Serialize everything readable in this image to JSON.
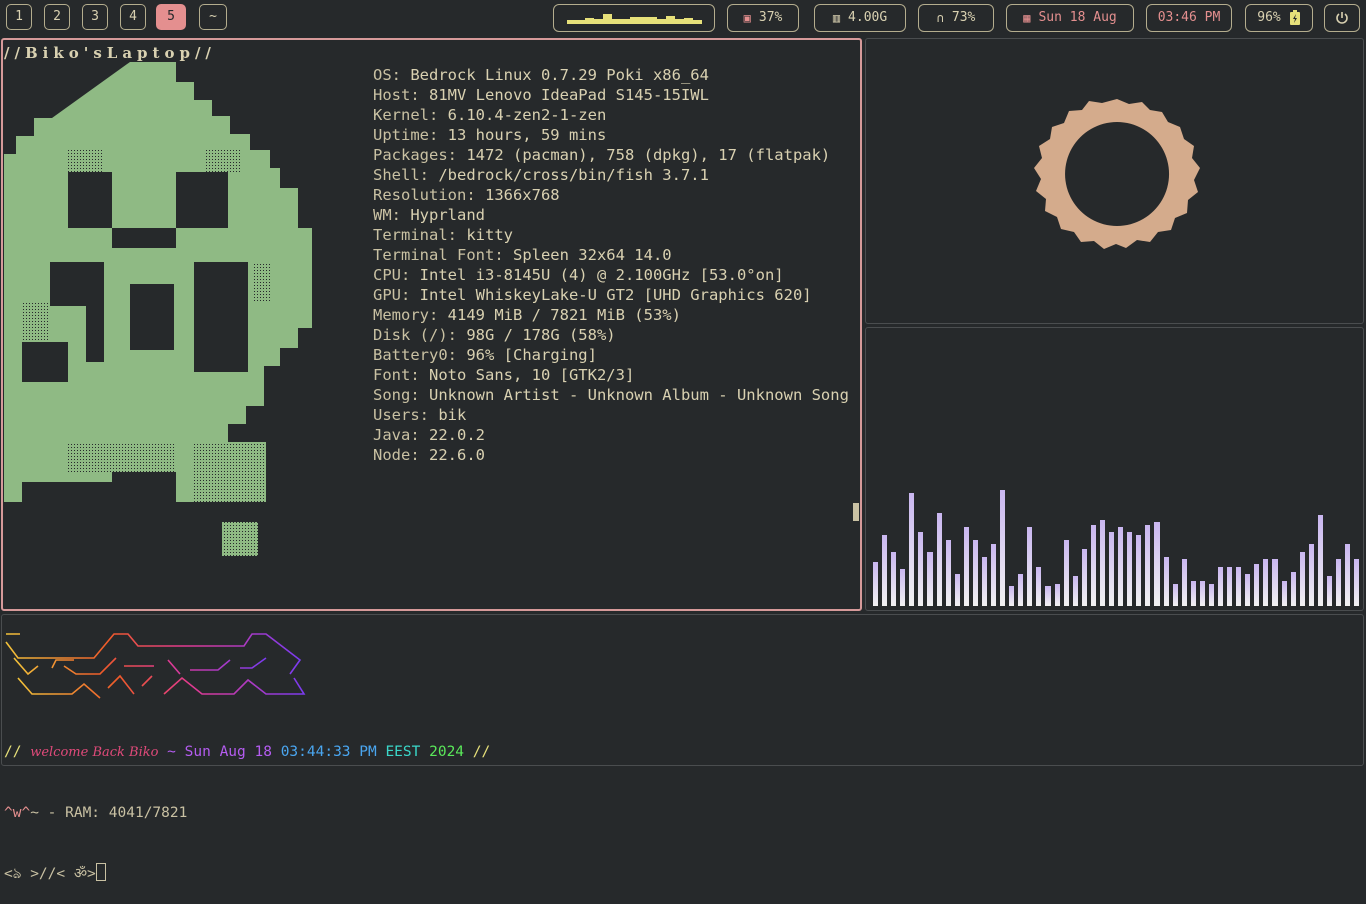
{
  "bar": {
    "workspaces": [
      {
        "label": "1",
        "active": false
      },
      {
        "label": "2",
        "active": false
      },
      {
        "label": "3",
        "active": false
      },
      {
        "label": "4",
        "active": false
      },
      {
        "label": "5",
        "active": true
      },
      {
        "label": "~",
        "active": false
      }
    ],
    "cpu": "37%",
    "memory": "4.00G",
    "volume": "73%",
    "date": "Sun 18 Aug",
    "time": "03:46 PM",
    "battery": "96%",
    "icons": {
      "cpu": "cpu-icon",
      "memory": "memory-icon",
      "volume": "headphones-icon",
      "date": "calendar-icon",
      "battery": "battery-charging-icon",
      "power": "power-icon"
    }
  },
  "fetch": {
    "title": "//Biko'sLaptop//",
    "rows": [
      {
        "key": "OS: ",
        "value": "Bedrock Linux 0.7.29 Poki x86_64"
      },
      {
        "key": "Host: ",
        "value": "81MV Lenovo IdeaPad S145-15IWL"
      },
      {
        "key": "Kernel: ",
        "value": "6.10.4-zen2-1-zen"
      },
      {
        "key": "Uptime: ",
        "value": "13 hours, 59 mins"
      },
      {
        "key": "Packages: ",
        "value": "1472 (pacman), 758 (dpkg), 17 (flatpak)"
      },
      {
        "key": "Shell: ",
        "value": "/bedrock/cross/bin/fish 3.7.1"
      },
      {
        "key": "Resolution: ",
        "value": "1366x768"
      },
      {
        "key": "WM: ",
        "value": "Hyprland"
      },
      {
        "key": "Terminal: ",
        "value": "kitty"
      },
      {
        "key": "Terminal Font: ",
        "value": "Spleen 32x64 14.0"
      },
      {
        "key": "CPU: ",
        "value": "Intel i3-8145U (4) @ 2.100GHz [53.0°on]"
      },
      {
        "key": "GPU: ",
        "value": "Intel WhiskeyLake-U GT2 [UHD Graphics 620]"
      },
      {
        "key": "Memory: ",
        "value": "4149 MiB / 7821 MiB (53%)"
      },
      {
        "key": "Disk (/): ",
        "value": "98G / 178G (58%)"
      },
      {
        "key": "Battery0: ",
        "value": "96% [Charging]"
      },
      {
        "key": "Font: ",
        "value": "Noto Sans, 10 [GTK2/3]"
      },
      {
        "key": "Song: ",
        "value": "Unknown Artist - Unknown Album - Unknown Song"
      },
      {
        "key": "Users: ",
        "value": "bik"
      },
      {
        "key": "Java: ",
        "value": "22.0.2"
      },
      {
        "key": "Node: ",
        "value": "22.6.0"
      }
    ]
  },
  "visualizer": {
    "levels": [
      0.18,
      0.29,
      0.22,
      0.15,
      0.46,
      0.3,
      0.22,
      0.38,
      0.27,
      0.13,
      0.32,
      0.27,
      0.2,
      0.25,
      0.47,
      0.08,
      0.13,
      0.32,
      0.16,
      0.08,
      0.09,
      0.27,
      0.12,
      0.23,
      0.33,
      0.35,
      0.3,
      0.32,
      0.3,
      0.29,
      0.33,
      0.34,
      0.2,
      0.09,
      0.19,
      0.1,
      0.1,
      0.09,
      0.16,
      0.16,
      0.16,
      0.13,
      0.17,
      0.19,
      0.19,
      0.1,
      0.14,
      0.22,
      0.25,
      0.37,
      0.12,
      0.19,
      0.25,
      0.19
    ],
    "colors": [
      "#c7b3ef",
      "#bcd6f2",
      "#f4f4f4"
    ]
  },
  "terminal": {
    "line1_prefix": "// ",
    "greeting": "welcome Back Biko",
    "tilde": " ~ ",
    "day": "Sun Aug 18 ",
    "clock": "03:44:33 PM ",
    "zone": "EEST ",
    "year": "2024 ",
    "line1_suffix": "//",
    "line2_face": "^w^",
    "line2_rest": "~ - RAM: 4041/7821",
    "prompt": "<ঌ >//< ॐ>"
  }
}
